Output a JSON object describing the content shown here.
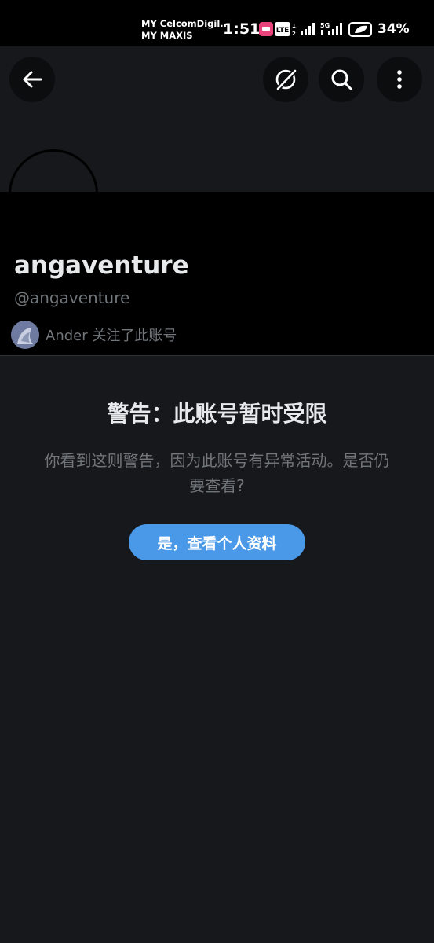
{
  "status_bar": {
    "carrier_line1": "MY CelcomDigil...",
    "carrier_line2": "MY MAXIS",
    "time": "1:51",
    "lte_label": "LTE",
    "network_5g": "5G",
    "battery_percent": "34%"
  },
  "header": {
    "back_icon": "arrow-left-icon",
    "grok_icon": "grok-icon",
    "search_icon": "search-icon",
    "more_icon": "more-vertical-icon"
  },
  "profile": {
    "display_name": "angaventure",
    "handle": "@angaventure",
    "followed_by": "Ander 关注了此账号"
  },
  "warning": {
    "title": "警告：此账号暂时受限",
    "body": "你看到这则警告，因为此账号有异常活动。是否仍要查看?",
    "confirm_button": "是，查看个人资料"
  },
  "colors": {
    "background": "#17181c",
    "accent": "#4a99e9",
    "muted_text": "#71767b"
  }
}
